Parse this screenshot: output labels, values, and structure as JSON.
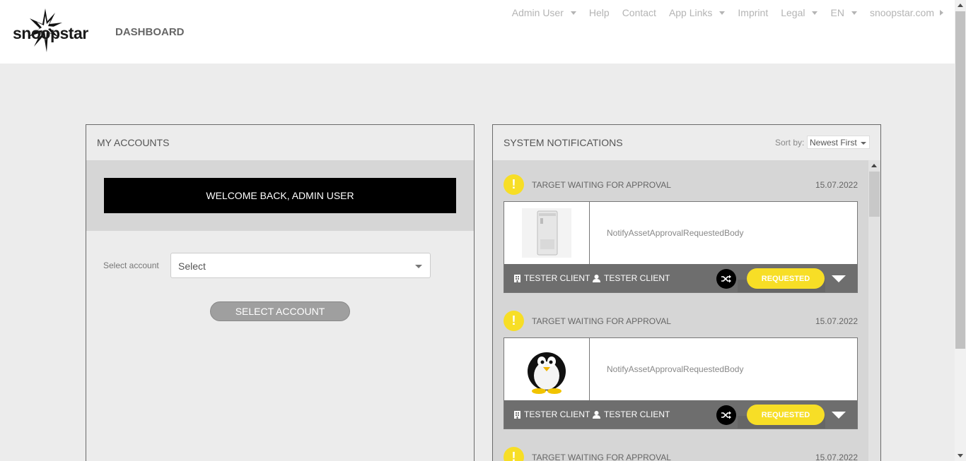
{
  "header": {
    "logo_text": "snoopstar",
    "page_title": "DASHBOARD",
    "nav": [
      {
        "label": "Admin User",
        "has_caret": true
      },
      {
        "label": "Help"
      },
      {
        "label": "Contact"
      },
      {
        "label": "App Links",
        "has_caret": true
      },
      {
        "label": "Imprint"
      },
      {
        "label": "Legal",
        "has_caret": true
      },
      {
        "label": "EN",
        "has_caret": true
      },
      {
        "label": "snoopstar.com",
        "has_arrow": true
      }
    ]
  },
  "accounts": {
    "title": "MY ACCOUNTS",
    "welcome": "WELCOME BACK, ADMIN USER",
    "select_label": "Select account",
    "select_value": "Select",
    "button": "SELECT ACCOUNT"
  },
  "notifications": {
    "title": "SYSTEM NOTIFICATIONS",
    "sort_label": "Sort by:",
    "sort_value": "Newest First",
    "items": [
      {
        "title": "TARGET WAITING FOR APPROVAL",
        "date": "15.07.2022",
        "body": "NotifyAssetApprovalRequestedBody",
        "client_company": "TESTER CLIENT",
        "client_user": "TESTER CLIENT",
        "status": "REQUESTED",
        "image": "air-conditioner"
      },
      {
        "title": "TARGET WAITING FOR APPROVAL",
        "date": "15.07.2022",
        "body": "NotifyAssetApprovalRequestedBody",
        "client_company": "TESTER CLIENT",
        "client_user": "TESTER CLIENT",
        "status": "REQUESTED",
        "image": "penguin"
      },
      {
        "title": "TARGET WAITING FOR APPROVAL",
        "date": "15.07.2022"
      }
    ]
  },
  "colors": {
    "accent": "#f7de26",
    "dark_bar": "#6e6e6e",
    "panel_band": "#d6d6d6"
  }
}
